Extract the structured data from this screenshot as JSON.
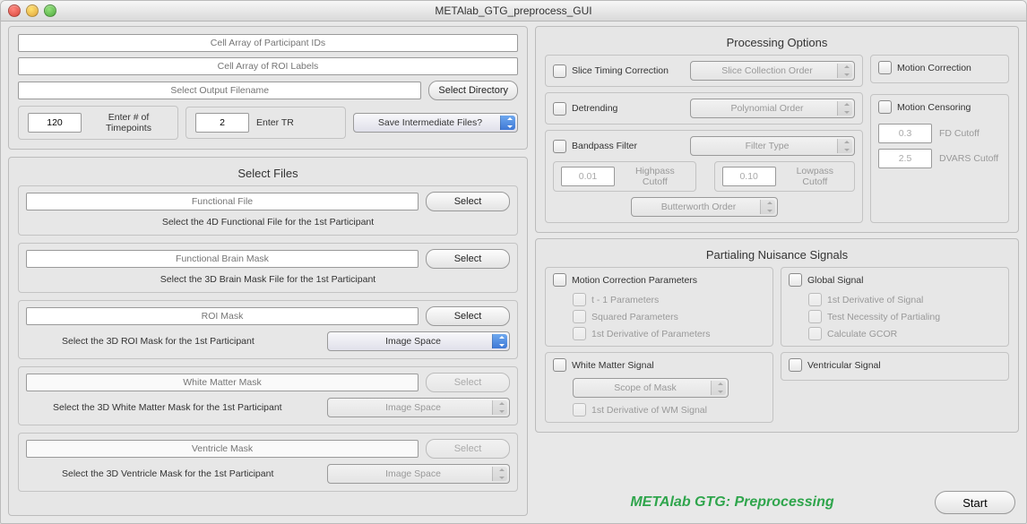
{
  "window": {
    "title": "METAlab_GTG_preprocess_GUI"
  },
  "inputs": {
    "participant_ids_placeholder": "Cell Array of Participant IDs",
    "roi_labels_placeholder": "Cell Array of ROI Labels",
    "output_filename_placeholder": "Select Output Filename",
    "select_directory": "Select Directory",
    "timepoints_value": "120",
    "timepoints_label": "Enter # of Timepoints",
    "tr_value": "2",
    "tr_label": "Enter TR",
    "save_intermediate": "Save Intermediate Files?"
  },
  "select_files": {
    "title": "Select Files",
    "functional": {
      "placeholder": "Functional File",
      "helper": "Select the 4D Functional File for the 1st Participant",
      "button": "Select"
    },
    "brain_mask": {
      "placeholder": "Functional Brain Mask",
      "helper": "Select the 3D Brain Mask File for the 1st Participant",
      "button": "Select"
    },
    "roi_mask": {
      "placeholder": "ROI Mask",
      "helper": "Select the 3D ROI Mask for the 1st Participant",
      "button": "Select",
      "space": "Image Space"
    },
    "wm_mask": {
      "placeholder": "White Matter Mask",
      "helper": "Select the 3D White Matter Mask for the 1st Participant",
      "button": "Select",
      "space": "Image Space"
    },
    "vent_mask": {
      "placeholder": "Ventricle Mask",
      "helper": "Select the 3D Ventricle Mask for the 1st Participant",
      "button": "Select",
      "space": "Image Space"
    }
  },
  "processing": {
    "title": "Processing Options",
    "slice_timing": {
      "label": "Slice Timing Correction",
      "popup": "Slice Collection Order"
    },
    "detrending": {
      "label": "Detrending",
      "popup": "Polynomial Order"
    },
    "bandpass": {
      "label": "Bandpass Filter",
      "filter_type": "Filter Type",
      "hp_value": "0.01",
      "hp_label": "Highpass Cutoff",
      "lp_value": "0.10",
      "lp_label": "Lowpass Cutoff",
      "bw_order": "Butterworth Order"
    },
    "motion_correction": "Motion Correction",
    "motion_censoring": {
      "label": "Motion Censoring",
      "fd_value": "0.3",
      "fd_label": "FD Cutoff",
      "dvars_value": "2.5",
      "dvars_label": "DVARS Cutoff"
    }
  },
  "partialing": {
    "title": "Partialing Nuisance Signals",
    "motion_params": {
      "label": "Motion Correction Parameters",
      "sub1": "t - 1 Parameters",
      "sub2": "Squared Parameters",
      "sub3": "1st Derivative of Parameters"
    },
    "global": {
      "label": "Global Signal",
      "sub1": "1st Derivative of Signal",
      "sub2": "Test Necessity of Partialing",
      "sub3": "Calculate GCOR"
    },
    "wm_signal": {
      "label": "White Matter Signal",
      "scope": "Scope of Mask",
      "sub1": "1st Derivative of WM Signal"
    },
    "ventricular": {
      "label": "Ventricular Signal"
    }
  },
  "footer": {
    "brand": "METAlab GTG: Preprocessing",
    "start": "Start"
  }
}
